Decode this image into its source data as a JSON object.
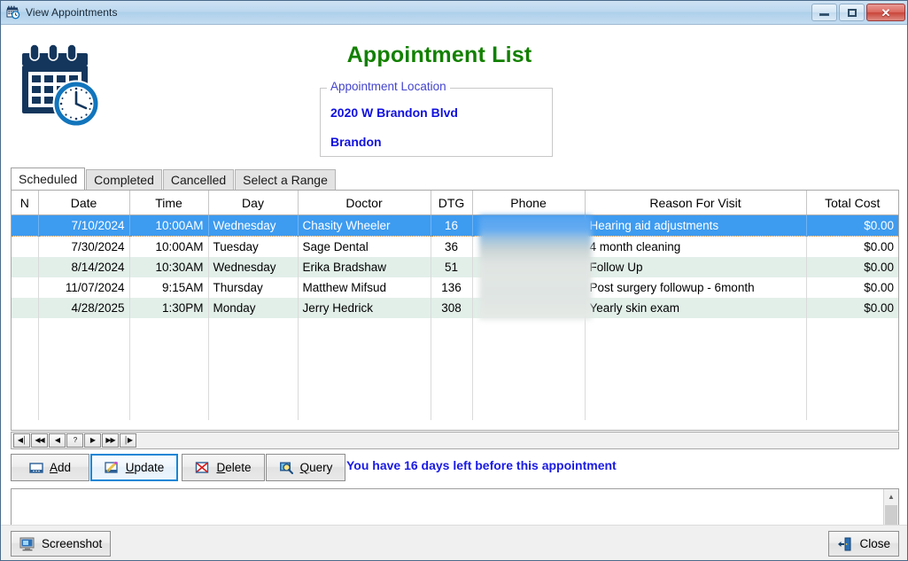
{
  "window": {
    "title": "View Appointments",
    "icon": "calendar-clock-icon",
    "controls": {
      "minimize": "–",
      "maximize": "□",
      "close": "✕"
    }
  },
  "header": {
    "logo_icon": "calendar-clock-logo",
    "page_title": "Appointment List",
    "title_color": "#128000",
    "location_group": {
      "legend": "Appointment Location",
      "address_line1": "2020 W Brandon Blvd",
      "address_line2": "Brandon",
      "text_color": "#1010e0"
    }
  },
  "tabs": [
    {
      "label": "Scheduled",
      "active": true
    },
    {
      "label": "Completed",
      "active": false
    },
    {
      "label": "Cancelled",
      "active": false
    },
    {
      "label": "Select a Range",
      "active": false
    }
  ],
  "grid": {
    "columns": [
      "N",
      "Date",
      "Time",
      "Day",
      "Doctor",
      "DTG",
      "Phone",
      "Reason For Visit",
      "Total Cost"
    ],
    "selected_row_index": 0,
    "selection_color": "#3d9bf0",
    "alt_row_color": "#e2efe9",
    "phone_column_redacted": true,
    "rows": [
      {
        "n": "",
        "date": "7/10/2024",
        "time": "10:00AM",
        "day": "Wednesday",
        "doctor": "Chasity Wheeler",
        "dtg": "16",
        "phone": "",
        "reason": "Hearing aid adjustments",
        "total_cost": "$0.00"
      },
      {
        "n": "",
        "date": "7/30/2024",
        "time": "10:00AM",
        "day": "Tuesday",
        "doctor": "Sage Dental",
        "dtg": "36",
        "phone": "",
        "reason": "4 month cleaning",
        "total_cost": "$0.00"
      },
      {
        "n": "",
        "date": "8/14/2024",
        "time": "10:30AM",
        "day": "Wednesday",
        "doctor": "Erika Bradshaw",
        "dtg": "51",
        "phone": "",
        "reason": "Follow Up",
        "total_cost": "$0.00"
      },
      {
        "n": "",
        "date": "11/07/2024",
        "time": "9:15AM",
        "day": "Thursday",
        "doctor": "Matthew Mifsud",
        "dtg": "136",
        "phone": "",
        "reason": "Post surgery followup - 6month",
        "total_cost": "$0.00"
      },
      {
        "n": "",
        "date": "4/28/2025",
        "time": "1:30PM",
        "day": "Monday",
        "doctor": "Jerry Hedrick",
        "dtg": "308",
        "phone": "",
        "reason": "Yearly skin exam",
        "total_cost": "$0.00"
      }
    ]
  },
  "navigator": {
    "buttons": [
      {
        "name": "first-record",
        "glyph": "◀│"
      },
      {
        "name": "prev-page",
        "glyph": "◀◀"
      },
      {
        "name": "prev-record",
        "glyph": "◀"
      },
      {
        "name": "help",
        "glyph": "?"
      },
      {
        "name": "next-record",
        "glyph": "▶"
      },
      {
        "name": "next-page",
        "glyph": "▶▶"
      },
      {
        "name": "last-record",
        "glyph": "│▶"
      }
    ]
  },
  "actions": {
    "add": {
      "label": "Add",
      "accel": "A",
      "icon": "insert-record-icon",
      "focused": false
    },
    "update": {
      "label": "Update",
      "accel": "U",
      "icon": "edit-pencil-icon",
      "focused": true
    },
    "delete": {
      "label": "Delete",
      "accel": "D",
      "icon": "delete-x-icon",
      "focused": false
    },
    "query": {
      "label": "Query",
      "accel": "Q",
      "icon": "magnifier-icon",
      "focused": false
    }
  },
  "status": {
    "message": "You have 16 days left before this appointment",
    "color": "#1a1ae6"
  },
  "memo": {
    "value": "",
    "scrollbar": {
      "up": "▲",
      "down": "▼"
    }
  },
  "footer": {
    "screenshot": {
      "label": "Screenshot",
      "icon": "monitor-screenshot-icon"
    },
    "close": {
      "label": "Close",
      "icon": "exit-door-icon"
    }
  }
}
